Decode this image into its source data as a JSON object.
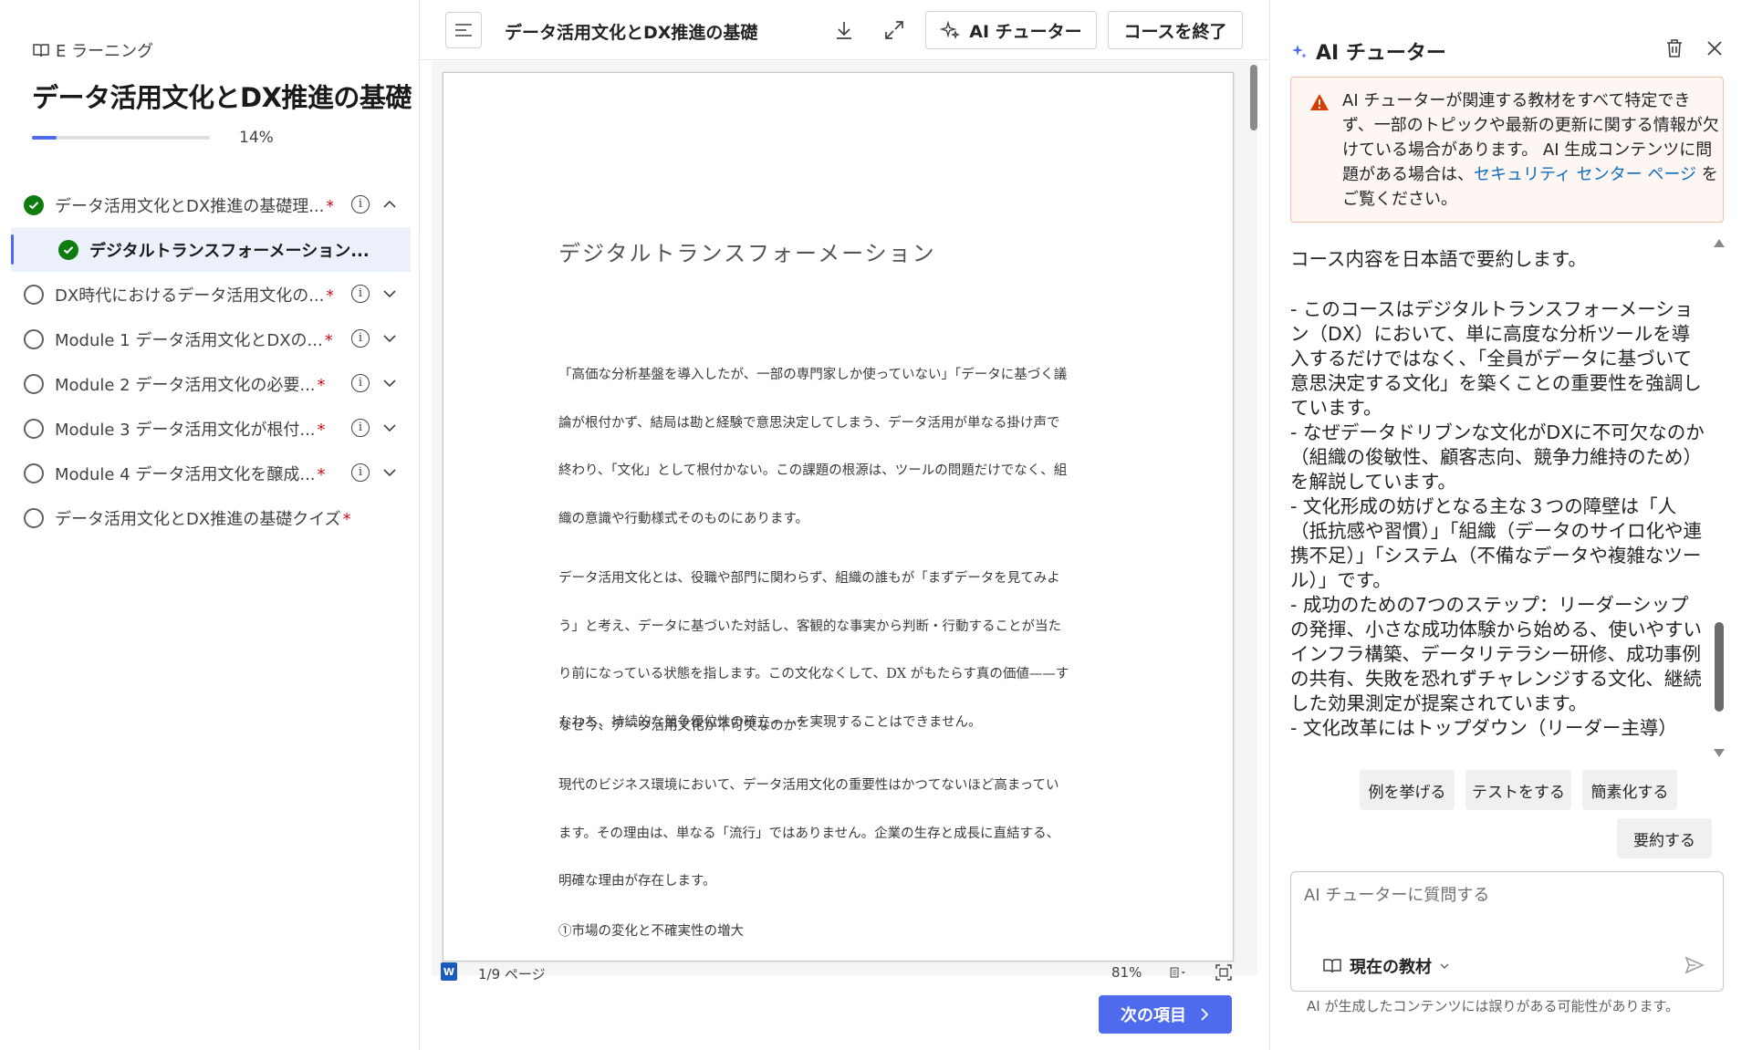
{
  "sidebar": {
    "brand": "E ラーニング",
    "course_title": "データ活用文化とDX推進の基礎",
    "progress": {
      "percent": 14,
      "label": "14%"
    },
    "items": [
      {
        "label": "データ活用文化とDX推進の基礎理...",
        "required": "*",
        "status": "done",
        "expanded": true
      },
      {
        "label": "デジタルトランスフォーメーション...",
        "status": "done",
        "sub": true
      },
      {
        "label": "DX時代におけるデータ活用文化の...",
        "required": "*",
        "status": "todo"
      },
      {
        "label": "Module 1 データ活用文化とDXの...",
        "required": "*",
        "status": "todo"
      },
      {
        "label": "Module 2 データ活用文化の必要...",
        "required": "*",
        "status": "todo"
      },
      {
        "label": "Module 3 データ活用文化が根付...",
        "required": "*",
        "status": "todo"
      },
      {
        "label": "Module 4 データ活用文化を醸成...",
        "required": "*",
        "status": "todo"
      },
      {
        "label": "データ活用文化とDX推進の基礎クイズ",
        "required": "*",
        "status": "todo"
      }
    ]
  },
  "viewer": {
    "doc_title": "データ活用文化とDX推進の基礎",
    "ai_tutor_button": "AI チューター",
    "end_course_button": "コースを終了",
    "page": {
      "heading": "デジタルトランスフォーメーション",
      "p1": [
        "「高価な分析基盤を導入したが、一部の専門家しか使っていない」「データに基づく議",
        "論が根付かず、結局は勘と経験で意思決定してしまう、データ活用が単なる掛け声で",
        "終わり、「文化」として根付かない。この課題の根源は、ツールの問題だけでなく、組",
        "織の意識や行動様式そのものにあります。"
      ],
      "p2": [
        "データ活用文化とは、役職や部門に関わらず、組織の誰もが「まずデータを見てみよ",
        "う」と考え、データに基づいた対話し、客観的な事実から判断・行動することが当た",
        "り前になっている状態を指します。この文化なくして、DX がもたらす真の価値——す",
        "なわち、持続的な競争優位性の確立——を実現することはできません。"
      ],
      "p3": "なぜ今、データ活用文化が不可欠なのか？",
      "p4": [
        "現代のビジネス環境において、データ活用文化の重要性はかつてないほど高まってい",
        "ます。その理由は、単なる「流行」ではありません。企業の生存と成長に直結する、",
        "明確な理由が存在します。"
      ],
      "p5": "①市場の変化と不確実性の増大"
    },
    "status": {
      "page_label": "1/9 ページ",
      "zoom": "81%"
    },
    "next_button": "次の項目"
  },
  "tutor": {
    "title": "AI チューター",
    "warning": {
      "text_before": "AI チューターが関連する教材をすべて特定できず、一部のトピックや最新の更新に関する情報が欠けている場合があります。 AI 生成コンテンツに問題がある場合は、",
      "link": "セキュリティ センター ページ",
      "text_after": " をご覧ください。"
    },
    "chat": {
      "intro": "コース内容を日本語で要約します。",
      "lines": [
        "- このコースはデジタルトランスフォーメーション（DX）において、単に高度な分析ツールを導入するだけではなく、「全員がデータに基づいて意思決定する文化」を築くことの重要性を強調しています。",
        "- なぜデータドリブンな文化がDXに不可欠なのか（組織の俊敏性、顧客志向、競争力維持のため）を解説しています。",
        "- 文化形成の妨げとなる主な３つの障壁は「人（抵抗感や習慣）」「組織（データのサイロ化や連携不足）」「システム（不備なデータや複雑なツール）」です。",
        "- 成功のための7つのステップ：リーダーシップの発揮、小さな成功体験から始める、使いやすいインフラ構築、データリテラシー研修、成功事例の共有、失敗を恐れずチャレンジする文化、継続した効果測定が提案されています。",
        "- 文化改革にはトップダウン（リーダー主導）"
      ]
    },
    "chips": [
      "例を挙げる",
      "テストをする",
      "簡素化する",
      "要約する"
    ],
    "composer": {
      "placeholder": "AI チューターに質問する",
      "scope": "現在の教材"
    },
    "disclaimer": "AI が生成したコンテンツには誤りがある可能性があります。"
  },
  "colors": {
    "accent": "#4f6bed",
    "success": "#107c10",
    "required": "#c50f1f",
    "warning_bg": "#fdf6f3",
    "warning_icon": "#da3b01",
    "link": "#0f6cbd"
  }
}
